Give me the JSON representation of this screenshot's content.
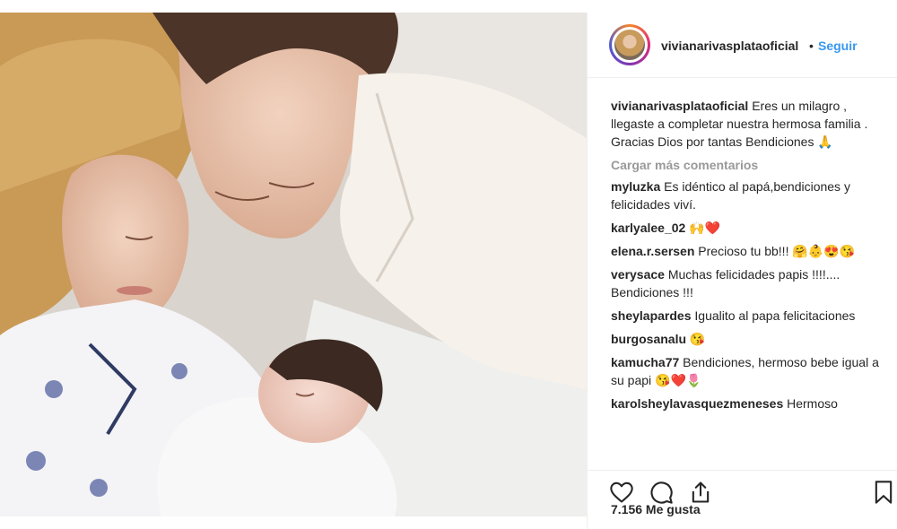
{
  "post": {
    "username": "vivianarivasplataoficial",
    "dot": "•",
    "follow_label": "Seguir",
    "caption_user": "vivianarivasplataoficial",
    "caption_text": "Eres un milagro , llegaste a completar nuestra hermosa familia . Gracias Dios por tantas Bendiciones 🙏",
    "load_more_label": "Cargar más comentarios",
    "likes_text": "7.156 Me gusta"
  },
  "comments": [
    {
      "user": "myluzka",
      "text": "Es idéntico al papá,bendiciones y felicidades viví."
    },
    {
      "user": "karlyalee_02",
      "text": "🙌❤️"
    },
    {
      "user": "elena.r.sersen",
      "text": "Precioso tu bb!!! 🤗👶😍😘"
    },
    {
      "user": "verysace",
      "text": "Muchas felicidades papis !!!!.... Bendiciones !!!"
    },
    {
      "user": "sheylapardes",
      "text": "Igualito al papa felicitaciones"
    },
    {
      "user": "burgosanalu",
      "text": "😘"
    },
    {
      "user": "kamucha77",
      "text": "Bendiciones, hermoso bebe igual a su papi 😘❤️🌷"
    },
    {
      "user": "karolsheylavasquezmeneses",
      "text": "Hermoso"
    }
  ],
  "icons": {
    "like": "heart-icon",
    "comment": "comment-icon",
    "share": "share-icon",
    "save": "bookmark-icon"
  }
}
